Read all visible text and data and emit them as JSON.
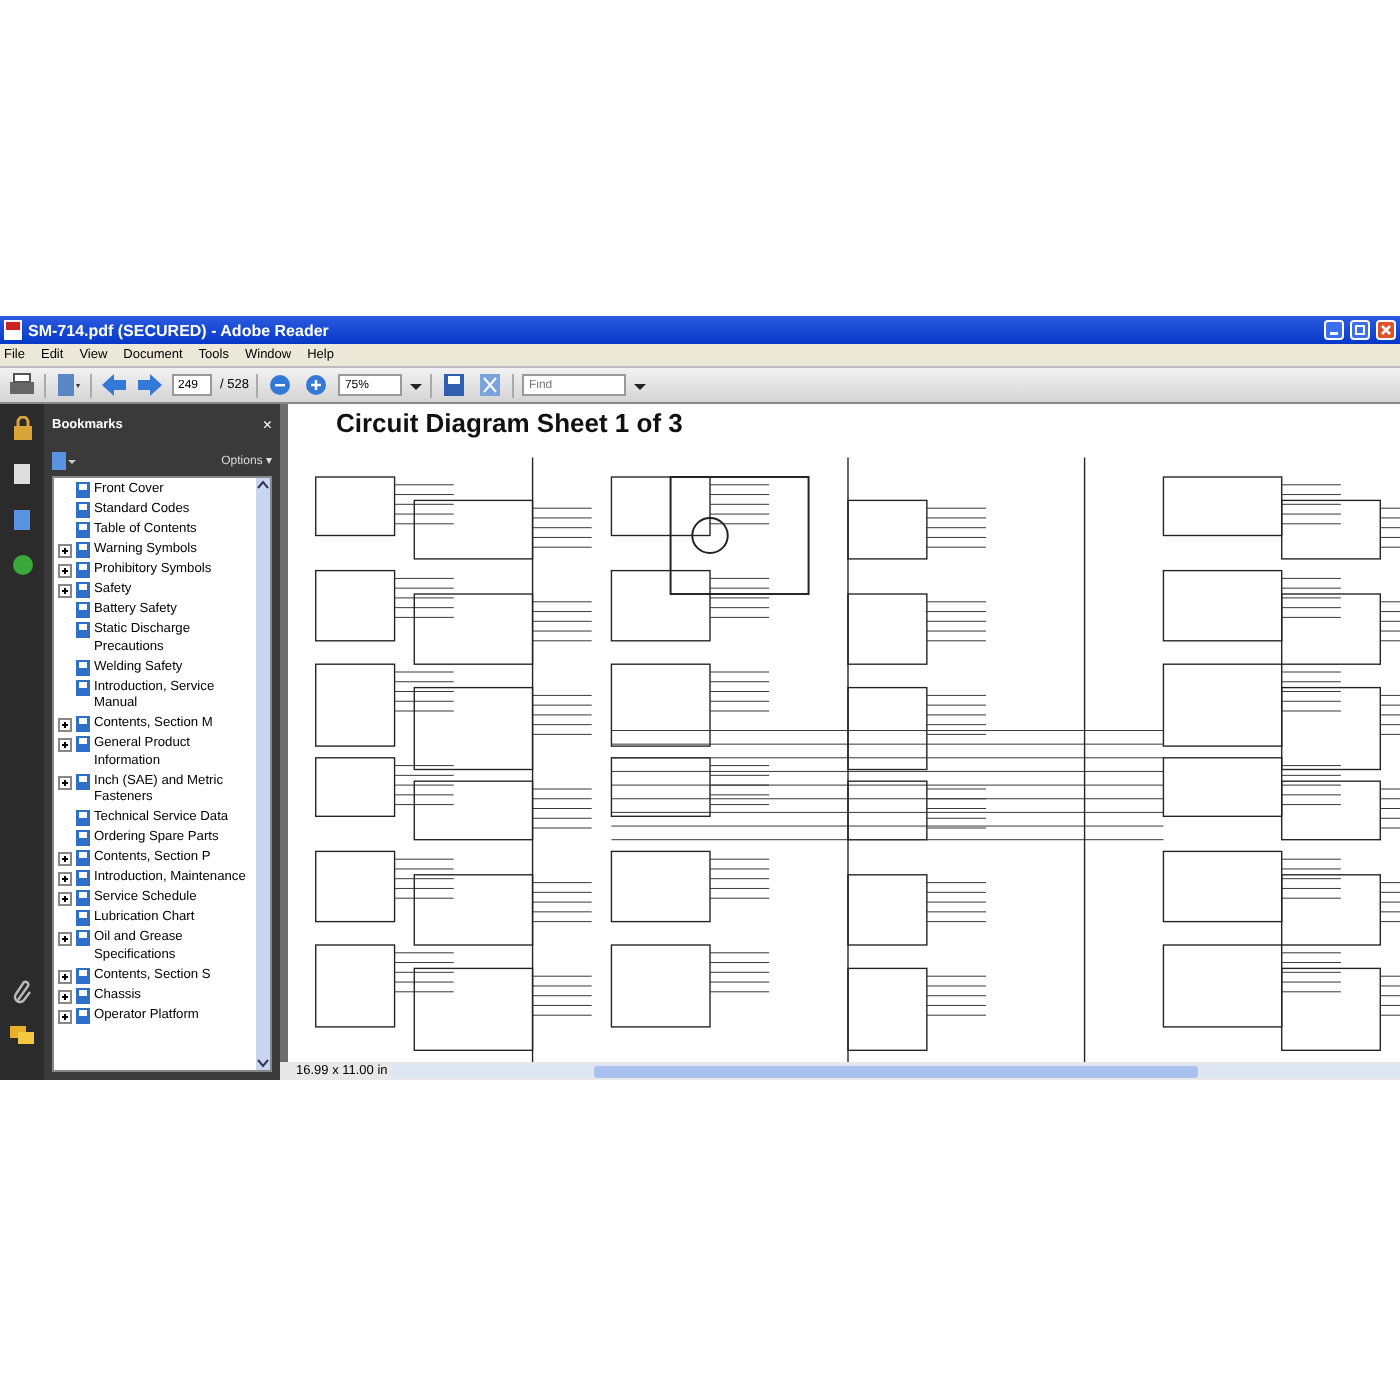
{
  "window": {
    "title": "SM-714.pdf (SECURED) - Adobe Reader"
  },
  "menu": [
    "File",
    "Edit",
    "View",
    "Document",
    "Tools",
    "Window",
    "Help"
  ],
  "toolbar": {
    "page": "249",
    "page_count": "/ 528",
    "zoom": "75%",
    "find": {
      "placeholder": "Find"
    }
  },
  "bookmarks": {
    "title": "Bookmarks",
    "close": "×",
    "options": "Options ▾",
    "items": [
      {
        "label": "Front Cover",
        "kind": "page"
      },
      {
        "label": "Standard Codes",
        "kind": "page"
      },
      {
        "label": "Table of Contents",
        "kind": "page"
      },
      {
        "label": "Warning Symbols",
        "kind": "group"
      },
      {
        "label": "Prohibitory Symbols",
        "kind": "group"
      },
      {
        "label": "Safety",
        "kind": "group"
      },
      {
        "label": "Battery Safety",
        "kind": "page"
      },
      {
        "label": "Static Discharge Precautions",
        "kind": "page"
      },
      {
        "label": "Welding Safety",
        "kind": "page"
      },
      {
        "label": "Introduction, Service Manual",
        "kind": "page"
      },
      {
        "label": "Contents, Section M",
        "kind": "group"
      },
      {
        "label": "General Product Information",
        "kind": "group"
      },
      {
        "label": "Inch (SAE) and Metric Fasteners",
        "kind": "group"
      },
      {
        "label": "Technical Service Data",
        "kind": "page"
      },
      {
        "label": "Ordering Spare Parts",
        "kind": "page"
      },
      {
        "label": "Contents, Section P",
        "kind": "group"
      },
      {
        "label": "Introduction, Maintenance",
        "kind": "group"
      },
      {
        "label": "Service Schedule",
        "kind": "group"
      },
      {
        "label": "Lubrication Chart",
        "kind": "page"
      },
      {
        "label": "Oil and Grease Specifications",
        "kind": "group"
      },
      {
        "label": "Contents, Section S",
        "kind": "group"
      },
      {
        "label": "Chassis",
        "kind": "group"
      },
      {
        "label": "Operator Platform",
        "kind": "group"
      }
    ]
  },
  "document": {
    "title": "Circuit Diagram Sheet 1 of 3"
  },
  "status_bar": {
    "page_size": "16.99 x 11.00 in"
  }
}
